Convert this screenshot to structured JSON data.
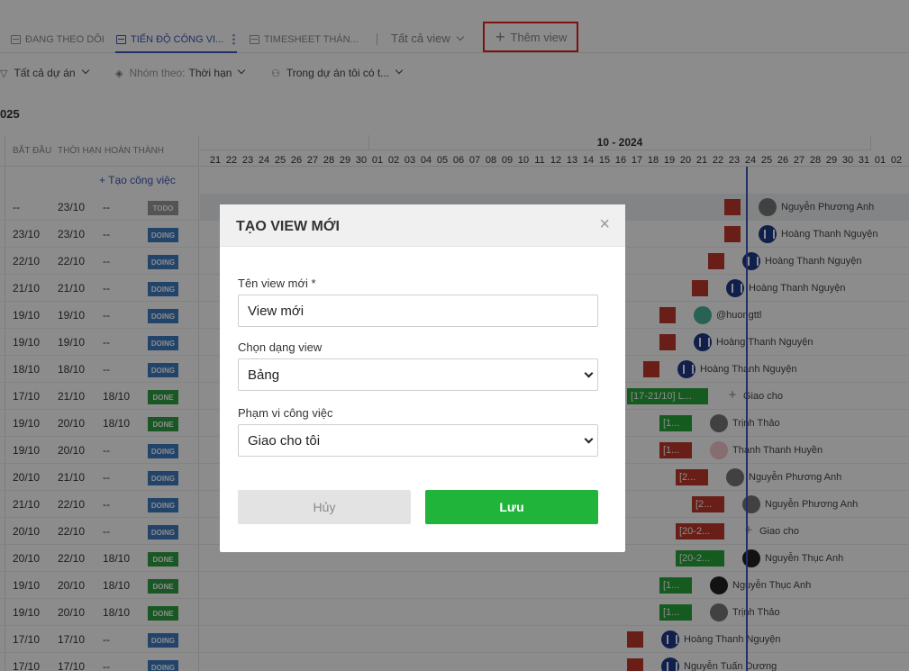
{
  "tabs": {
    "following": "ĐANG THEO DÕI",
    "progress": "TIẾN ĐỘ CÔNG VI...",
    "timesheet": "TIMESHEET THÁN...",
    "all_views": "Tất cả view",
    "add_view": "Thêm view"
  },
  "filters": {
    "projects": "Tất cả dự án",
    "group_by_prefix": "Nhóm theo:",
    "group_by_value": "Thời hạn",
    "membership": "Trong dự án tôi có t..."
  },
  "year_label": "025",
  "columns": {
    "start": "BẮT ĐẦU",
    "deadline": "THỜI HẠN",
    "done": "HOÀN THÀNH"
  },
  "add_task": "+ Tạo công việc",
  "timeline": {
    "month": "10 - 2024",
    "days": [
      "21",
      "22",
      "23",
      "24",
      "25",
      "26",
      "27",
      "28",
      "29",
      "30",
      "01",
      "02",
      "03",
      "04",
      "05",
      "06",
      "07",
      "08",
      "09",
      "10",
      "11",
      "12",
      "13",
      "14",
      "15",
      "16",
      "17",
      "18",
      "19",
      "20",
      "21",
      "22",
      "23",
      "24",
      "25",
      "26",
      "27",
      "28",
      "29",
      "30",
      "31",
      "01",
      "02"
    ]
  },
  "rows": [
    {
      "start": "--",
      "deadline": "23/10",
      "done": "--",
      "status": "TODO",
      "person": "Nguyễn Phương Anh",
      "bar": ""
    },
    {
      "start": "23/10",
      "deadline": "23/10",
      "done": "--",
      "status": "DOING",
      "person": "Hoàng Thanh Nguyện",
      "bar": ""
    },
    {
      "start": "22/10",
      "deadline": "22/10",
      "done": "--",
      "status": "DOING",
      "person": "Hoàng Thanh Nguyện",
      "bar": ""
    },
    {
      "start": "21/10",
      "deadline": "21/10",
      "done": "--",
      "status": "DOING",
      "person": "Hoàng Thanh Nguyện",
      "bar": ""
    },
    {
      "start": "19/10",
      "deadline": "19/10",
      "done": "--",
      "status": "DOING",
      "person": "@huongttl",
      "bar": ""
    },
    {
      "start": "19/10",
      "deadline": "19/10",
      "done": "--",
      "status": "DOING",
      "person": "Hoàng Thanh Nguyện",
      "bar": ""
    },
    {
      "start": "18/10",
      "deadline": "18/10",
      "done": "--",
      "status": "DOING",
      "person": "Hoàng Thanh Nguyện",
      "bar": ""
    },
    {
      "start": "17/10",
      "deadline": "21/10",
      "done": "18/10",
      "status": "DONE",
      "person": "Giao cho",
      "bar": "[17-21/10] L..."
    },
    {
      "start": "19/10",
      "deadline": "20/10",
      "done": "18/10",
      "status": "DONE",
      "person": "Trịnh Thảo",
      "bar": "[1..."
    },
    {
      "start": "19/10",
      "deadline": "20/10",
      "done": "--",
      "status": "DOING",
      "person": "Thạnh Thanh Huyền",
      "bar": "[1..."
    },
    {
      "start": "20/10",
      "deadline": "21/10",
      "done": "--",
      "status": "DOING",
      "person": "Nguyễn Phương Anh",
      "bar": "[2..."
    },
    {
      "start": "21/10",
      "deadline": "22/10",
      "done": "--",
      "status": "DOING",
      "person": "Nguyễn Phương Anh",
      "bar": "[2..."
    },
    {
      "start": "20/10",
      "deadline": "22/10",
      "done": "--",
      "status": "DOING",
      "person": "Giao cho",
      "bar": "[20-2..."
    },
    {
      "start": "20/10",
      "deadline": "22/10",
      "done": "18/10",
      "status": "DONE",
      "person": "Nguyễn Thục Anh",
      "bar": "[20-2..."
    },
    {
      "start": "19/10",
      "deadline": "20/10",
      "done": "18/10",
      "status": "DONE",
      "person": "Nguyễn Thục Anh",
      "bar": "[1..."
    },
    {
      "start": "19/10",
      "deadline": "20/10",
      "done": "18/10",
      "status": "DONE",
      "person": "Trịnh Thảo",
      "bar": "[1..."
    },
    {
      "start": "17/10",
      "deadline": "17/10",
      "done": "--",
      "status": "DOING",
      "person": "Hoàng Thanh Nguyện",
      "bar": ""
    },
    {
      "start": "17/10",
      "deadline": "17/10",
      "done": "--",
      "status": "DOING",
      "person": "Nguyễn Tuấn Dương",
      "bar": ""
    }
  ],
  "modal": {
    "title": "TẠO VIEW MỚI",
    "close": "×",
    "name_label": "Tên view mới *",
    "name_value": "View mới",
    "type_label": "Chọn dạng view",
    "type_value": "Bảng",
    "scope_label": "Phạm vi công việc",
    "scope_value": "Giao cho tôi",
    "cancel": "Hủy",
    "save": "Lưu"
  },
  "colors": {
    "accent": "#3d57b8",
    "save": "#21b43a",
    "highlight": "#e02020"
  }
}
